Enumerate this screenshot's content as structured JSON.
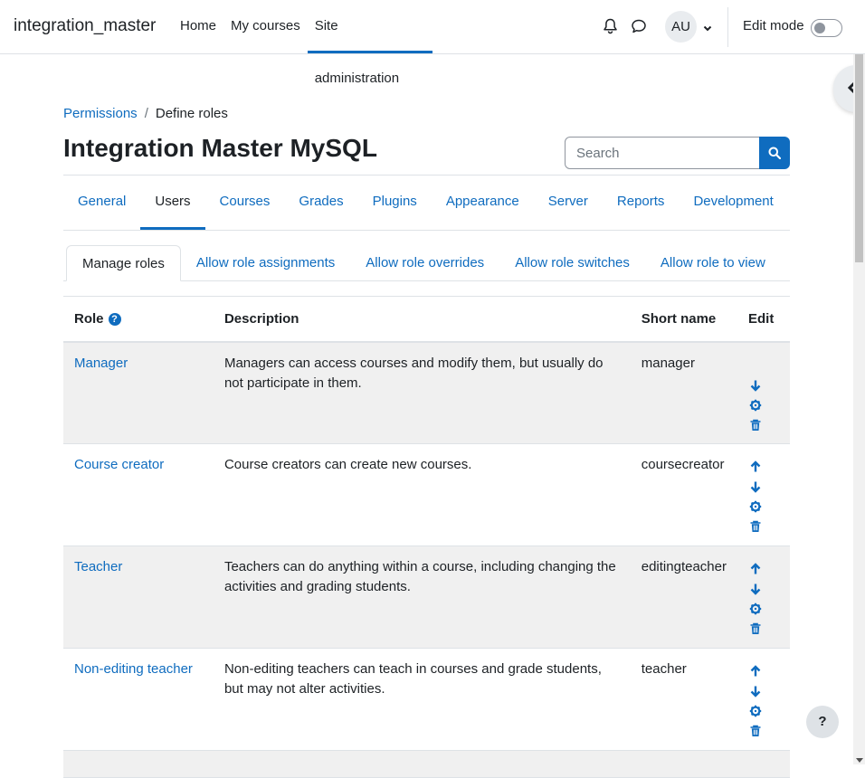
{
  "navbar": {
    "site_name": "integration_master",
    "links": [
      {
        "label": "Home"
      },
      {
        "label": "My courses"
      },
      {
        "label": "Site administration"
      }
    ],
    "user_initials": "AU",
    "edit_mode_label": "Edit mode"
  },
  "breadcrumb": {
    "items": [
      {
        "label": "Permissions"
      },
      {
        "label": "Define roles"
      }
    ]
  },
  "page_title": "Integration Master MySQL",
  "search": {
    "placeholder": "Search"
  },
  "admin_tabs": [
    {
      "label": "General"
    },
    {
      "label": "Users"
    },
    {
      "label": "Courses"
    },
    {
      "label": "Grades"
    },
    {
      "label": "Plugins"
    },
    {
      "label": "Appearance"
    },
    {
      "label": "Server"
    },
    {
      "label": "Reports"
    },
    {
      "label": "Development"
    }
  ],
  "role_tabs": [
    {
      "label": "Manage roles"
    },
    {
      "label": "Allow role assignments"
    },
    {
      "label": "Allow role overrides"
    },
    {
      "label": "Allow role switches"
    },
    {
      "label": "Allow role to view"
    }
  ],
  "table": {
    "headers": {
      "role": "Role",
      "description": "Description",
      "short_name": "Short name",
      "edit": "Edit"
    },
    "rows": [
      {
        "role": "Manager",
        "description": "Managers can access courses and modify them, but usually do not participate in them.",
        "short_name": "manager"
      },
      {
        "role": "Course creator",
        "description": "Course creators can create new courses.",
        "short_name": "coursecreator"
      },
      {
        "role": "Teacher",
        "description": "Teachers can do anything within a course, including changing the activities and grading students.",
        "short_name": "editingteacher"
      },
      {
        "role": "Non-editing teacher",
        "description": "Non-editing teachers can teach in courses and grade students, but may not alter activities.",
        "short_name": "teacher"
      }
    ]
  },
  "help_button_label": "?",
  "colors": {
    "accent": "#0f6cbf",
    "row_stripe": "#f0f0f0"
  }
}
